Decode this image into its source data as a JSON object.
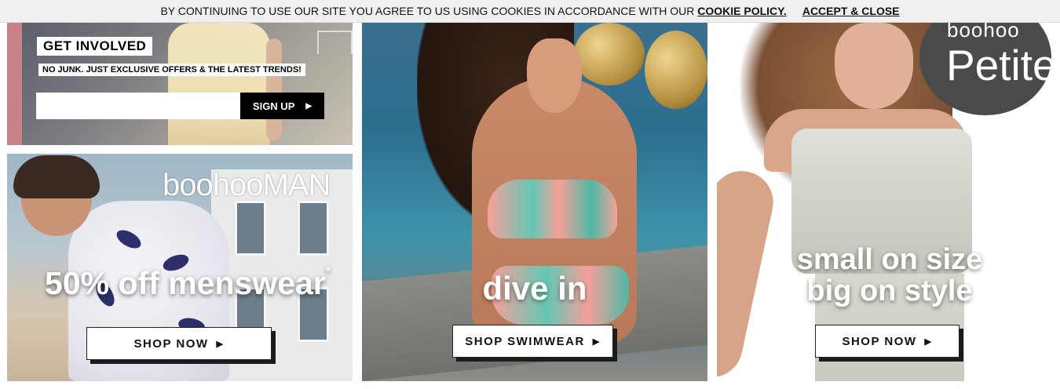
{
  "cookie_bar": {
    "message": "BY CONTINUING TO USE OUR SITE YOU AGREE TO US USING COOKIES IN ACCORDANCE WITH OUR",
    "policy_link": "COOKIE POLICY.",
    "accept_label": "ACCEPT & CLOSE"
  },
  "newsletter": {
    "heading": "GET INVOLVED",
    "subheading": "NO JUNK. JUST EXCLUSIVE OFFERS & THE LATEST TRENDS!",
    "email_value": "",
    "signup_label": "SIGN UP",
    "signup_icon": "caret-right-icon"
  },
  "menswear": {
    "logo_lower": "boohoo",
    "logo_upper": "MAN",
    "offer": "50% off menswear",
    "asterisk": "*",
    "button_label": "SHOP NOW"
  },
  "swimwear": {
    "headline": "dive in",
    "button_label": "SHOP SWIMWEAR"
  },
  "petite": {
    "brand": "boohoo",
    "brand_word": "Petite",
    "headline_line1": "small on size",
    "headline_line2": "big on style",
    "button_label": "SHOP NOW"
  },
  "icons": {
    "button_arrow": "▶",
    "signup_arrow": "▶"
  },
  "colors": {
    "cookie_bg": "#f0f0f0",
    "signup_bg": "#000000",
    "pink_accent": "#c9828a",
    "petite_circle": "#4a4a4a"
  }
}
